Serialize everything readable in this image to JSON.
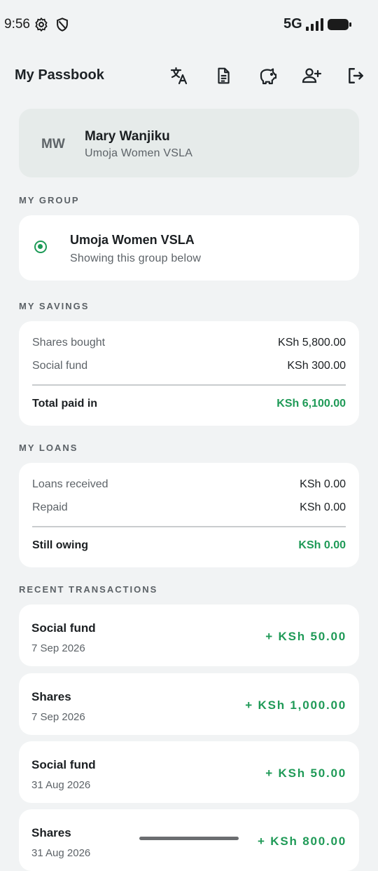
{
  "status_bar": {
    "time": "9:56",
    "network": "5G"
  },
  "app_bar": {
    "title": "My Passbook",
    "actions": [
      "translate-icon",
      "document-icon",
      "piggy-bank-icon",
      "add-member-icon",
      "logout-icon"
    ]
  },
  "profile": {
    "initials": "MW",
    "name": "Mary Wanjiku",
    "group": "Umoja Women VSLA"
  },
  "my_group": {
    "heading": "MY GROUP",
    "name": "Umoja Women VSLA",
    "subtitle": "Showing this group below"
  },
  "savings": {
    "heading": "MY SAVINGS",
    "rows": [
      {
        "label": "Shares bought",
        "value": "KSh 5,800.00"
      },
      {
        "label": "Social fund",
        "value": "KSh 300.00"
      }
    ],
    "total": {
      "label": "Total paid in",
      "value": "KSh 6,100.00"
    }
  },
  "loans": {
    "heading": "MY LOANS",
    "rows": [
      {
        "label": "Loans received",
        "value": "KSh 0.00"
      },
      {
        "label": "Repaid",
        "value": "KSh 0.00"
      }
    ],
    "total": {
      "label": "Still owing",
      "value": "KSh 0.00"
    }
  },
  "transactions": {
    "heading": "RECENT TRANSACTIONS",
    "items": [
      {
        "title": "Social fund",
        "date": "7 Sep 2026",
        "amount": "+ KSh 50.00"
      },
      {
        "title": "Shares",
        "date": "7 Sep 2026",
        "amount": "+ KSh 1,000.00"
      },
      {
        "title": "Social fund",
        "date": "31 Aug 2026",
        "amount": "+ KSh 50.00"
      },
      {
        "title": "Shares",
        "date": "31 Aug 2026",
        "amount": "+ KSh 800.00"
      }
    ]
  },
  "colors": {
    "accent_green": "#1f9a57",
    "background": "#f1f3f4",
    "profile_card": "#e6ebea"
  }
}
